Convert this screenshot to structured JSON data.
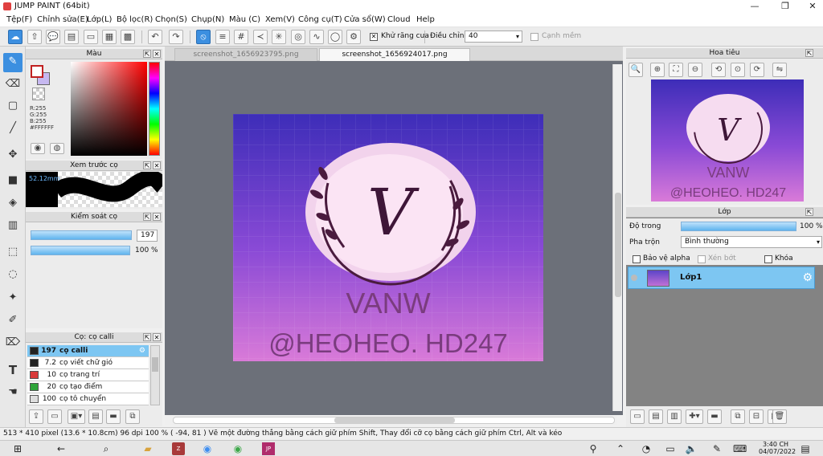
{
  "window": {
    "title": "JUMP PAINT (64bit)",
    "min": "—",
    "max": "❐",
    "close": "✕"
  },
  "menu": [
    "Tệp(F)",
    "Chỉnh sửa(E)",
    "Lớp(L)",
    "Bộ lọc(R)",
    "Chọn(S)",
    "Chụp(N)",
    "Màu (C)",
    "Xem(V)",
    "Công cụ(T)",
    "Cửa sổ(W)",
    "Cloud",
    "Help"
  ],
  "toolbar": {
    "antialias_label": "Khử răng cưa",
    "antialias_checked": "✕",
    "adjust_label": "Điều chỉnh",
    "adjust_value": "40",
    "edge_label": "Cạnh mềm"
  },
  "color_panel": {
    "title": "Màu",
    "r": "R:255",
    "g": "G:255",
    "b": "B:255",
    "hex": "#FFFFFF"
  },
  "brush_preview": {
    "title": "Xem trước cọ",
    "size": "52.12mm"
  },
  "brush_control": {
    "title": "Kiểm soát cọ",
    "size_value": "197",
    "opacity_value": "100 %"
  },
  "brush_list": {
    "title": "Cọ: cọ calli",
    "items": [
      {
        "size": "197",
        "name": "cọ calli",
        "color": "#222222",
        "selected": true
      },
      {
        "size": "7.2",
        "name": "cọ viết chữ gió",
        "color": "#222222",
        "selected": false
      },
      {
        "size": "10",
        "name": "cọ trang trí",
        "color": "#d83a3a",
        "selected": false
      },
      {
        "size": "20",
        "name": "cọ tạo điểm",
        "color": "#2fa53a",
        "selected": false
      },
      {
        "size": "100",
        "name": "cọ tô chuyển",
        "color": "#dddddd",
        "selected": false
      }
    ]
  },
  "tabs": [
    {
      "label": "screenshot_1656923795.png",
      "active": false
    },
    {
      "label": "screenshot_1656924017.png",
      "active": true
    }
  ],
  "artwork": {
    "letter": "V",
    "word": "VANW",
    "credit": "@HEOHEO. HD247"
  },
  "navigator": {
    "title": "Hoa tiêu"
  },
  "layer_panel": {
    "title": "Lớp",
    "opacity_label": "Độ trong",
    "opacity_value": "100 %",
    "blend_label": "Pha trộn",
    "blend_value": "Bình thường",
    "protect_alpha": "Bảo vệ alpha",
    "clip": "Xén bớt",
    "lock": "Khóa",
    "layer_name": "Lớp1"
  },
  "status": {
    "text": "513 * 410 pixel  (13.6 * 10.8cm)  96 dpi  100 %  ( -94, 81 )  Vẽ một đường thẳng bằng cách giữ phím Shift, Thay đổi cỡ cọ bằng cách giữ phím Ctrl, Alt và kéo"
  },
  "taskbar": {
    "time": "3:40 CH",
    "date": "04/07/2022"
  }
}
